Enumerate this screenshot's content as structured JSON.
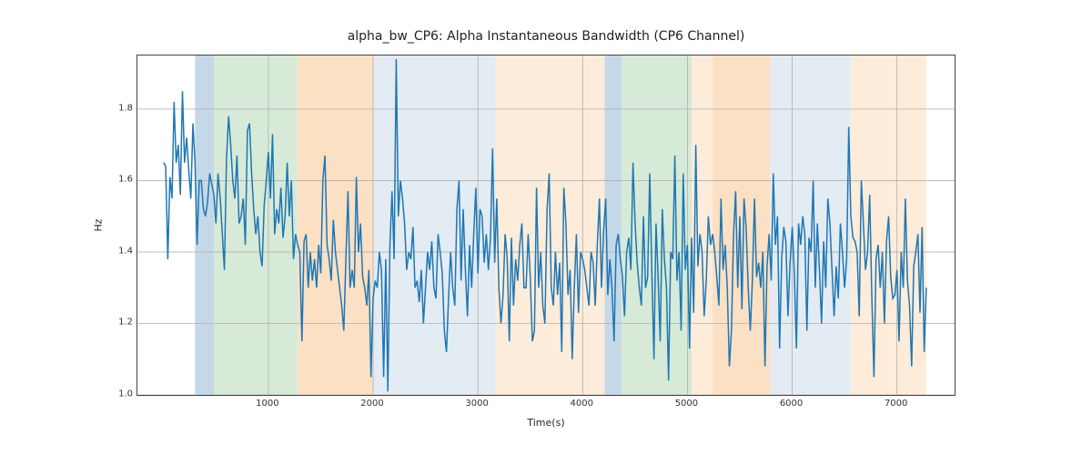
{
  "chart_data": {
    "type": "line",
    "title": "alpha_bw_CP6: Alpha Instantaneous Bandwidth (CP6 Channel)",
    "xlabel": "Time(s)",
    "ylabel": "Hz",
    "xlim": [
      -250,
      7550
    ],
    "ylim": [
      1.0,
      1.95
    ],
    "x_ticks": [
      1000,
      2000,
      3000,
      4000,
      5000,
      6000,
      7000
    ],
    "y_ticks": [
      1.0,
      1.2,
      1.4,
      1.6,
      1.8
    ],
    "bands": [
      {
        "start": 300,
        "end": 480,
        "color": "#c5d8e8",
        "label": "steelblue"
      },
      {
        "start": 480,
        "end": 1280,
        "color": "#d7ead7",
        "label": "green"
      },
      {
        "start": 1280,
        "end": 2000,
        "color": "#fbe0c4",
        "label": "orange"
      },
      {
        "start": 2000,
        "end": 3020,
        "color": "#e3ebf3",
        "label": "steelblue-light"
      },
      {
        "start": 3020,
        "end": 3170,
        "color": "#e3ebf3",
        "label": "steelblue-light"
      },
      {
        "start": 3170,
        "end": 4210,
        "color": "#fdecd9",
        "label": "orange-light"
      },
      {
        "start": 4210,
        "end": 4370,
        "color": "#c5d8e8",
        "label": "steelblue"
      },
      {
        "start": 4370,
        "end": 5040,
        "color": "#d7ead7",
        "label": "green"
      },
      {
        "start": 5040,
        "end": 5240,
        "color": "#fdecd9",
        "label": "orange-light"
      },
      {
        "start": 5240,
        "end": 5790,
        "color": "#fbe0c4",
        "label": "orange"
      },
      {
        "start": 5790,
        "end": 6560,
        "color": "#e3ebf3",
        "label": "steelblue-light"
      },
      {
        "start": 6560,
        "end": 7280,
        "color": "#fdecd9",
        "label": "orange-light"
      }
    ],
    "series": [
      {
        "name": "alpha_bw_CP6",
        "color": "#1f77b4",
        "x_step": 20,
        "values": [
          1.65,
          1.64,
          1.38,
          1.61,
          1.55,
          1.82,
          1.65,
          1.7,
          1.56,
          1.85,
          1.65,
          1.72,
          1.63,
          1.55,
          1.76,
          1.65,
          1.42,
          1.6,
          1.6,
          1.52,
          1.5,
          1.54,
          1.62,
          1.59,
          1.56,
          1.48,
          1.62,
          1.55,
          1.45,
          1.35,
          1.66,
          1.78,
          1.7,
          1.6,
          1.55,
          1.67,
          1.48,
          1.5,
          1.55,
          1.42,
          1.74,
          1.76,
          1.62,
          1.52,
          1.45,
          1.5,
          1.4,
          1.36,
          1.53,
          1.6,
          1.68,
          1.55,
          1.73,
          1.45,
          1.52,
          1.48,
          1.58,
          1.44,
          1.5,
          1.65,
          1.5,
          1.6,
          1.38,
          1.45,
          1.42,
          1.4,
          1.15,
          1.43,
          1.45,
          1.3,
          1.4,
          1.32,
          1.38,
          1.3,
          1.42,
          1.34,
          1.6,
          1.67,
          1.42,
          1.38,
          1.32,
          1.49,
          1.4,
          1.35,
          1.3,
          1.25,
          1.18,
          1.38,
          1.57,
          1.3,
          1.35,
          1.3,
          1.61,
          1.4,
          1.48,
          1.33,
          1.3,
          1.25,
          1.35,
          1.05,
          1.27,
          1.32,
          1.3,
          1.4,
          1.35,
          1.05,
          1.38,
          1.01,
          1.42,
          1.57,
          1.38,
          1.94,
          1.5,
          1.6,
          1.55,
          1.48,
          1.35,
          1.4,
          1.38,
          1.47,
          1.3,
          1.32,
          1.26,
          1.35,
          1.2,
          1.3,
          1.4,
          1.35,
          1.43,
          1.3,
          1.27,
          1.45,
          1.4,
          1.34,
          1.18,
          1.12,
          1.27,
          1.4,
          1.3,
          1.25,
          1.52,
          1.6,
          1.32,
          1.52,
          1.35,
          1.22,
          1.42,
          1.3,
          1.45,
          1.58,
          1.34,
          1.52,
          1.5,
          1.37,
          1.45,
          1.35,
          1.44,
          1.69,
          1.37,
          1.55,
          1.3,
          1.2,
          1.28,
          1.45,
          1.38,
          1.15,
          1.44,
          1.25,
          1.38,
          1.32,
          1.42,
          1.48,
          1.3,
          1.3,
          1.45,
          1.33,
          1.15,
          1.18,
          1.58,
          1.3,
          1.4,
          1.25,
          1.2,
          1.52,
          1.62,
          1.3,
          1.25,
          1.4,
          1.28,
          1.37,
          1.12,
          1.58,
          1.48,
          1.28,
          1.35,
          1.1,
          1.3,
          1.45,
          1.23,
          1.4,
          1.38,
          1.35,
          1.3,
          1.25,
          1.4,
          1.37,
          1.25,
          1.42,
          1.55,
          1.3,
          1.46,
          1.55,
          1.28,
          1.38,
          1.3,
          1.15,
          1.42,
          1.45,
          1.38,
          1.33,
          1.22,
          1.4,
          1.44,
          1.35,
          1.65,
          1.48,
          1.37,
          1.3,
          1.25,
          1.5,
          1.3,
          1.33,
          1.62,
          1.35,
          1.1,
          1.48,
          1.33,
          1.15,
          1.52,
          1.38,
          1.3,
          1.04,
          1.4,
          1.38,
          1.67,
          1.32,
          1.4,
          1.18,
          1.62,
          1.35,
          1.42,
          1.13,
          1.44,
          1.23,
          1.7,
          1.36,
          1.45,
          1.4,
          1.22,
          1.32,
          1.5,
          1.42,
          1.45,
          1.4,
          1.33,
          1.25,
          1.55,
          1.35,
          1.42,
          1.3,
          1.08,
          1.18,
          1.45,
          1.57,
          1.3,
          1.5,
          1.24,
          1.55,
          1.47,
          1.3,
          1.18,
          1.32,
          1.55,
          1.33,
          1.37,
          1.3,
          1.4,
          1.08,
          1.36,
          1.45,
          1.32,
          1.62,
          1.42,
          1.5,
          1.13,
          1.38,
          1.47,
          1.43,
          1.22,
          1.37,
          1.47,
          1.34,
          1.13,
          1.48,
          1.42,
          1.5,
          1.45,
          1.18,
          1.44,
          1.4,
          1.6,
          1.3,
          1.48,
          1.35,
          1.2,
          1.43,
          1.3,
          1.55,
          1.48,
          1.35,
          1.22,
          1.36,
          1.27,
          1.48,
          1.4,
          1.3,
          1.38,
          1.75,
          1.5,
          1.44,
          1.43,
          1.4,
          1.22,
          1.6,
          1.48,
          1.35,
          1.4,
          1.56,
          1.28,
          1.05,
          1.38,
          1.42,
          1.3,
          1.4,
          1.2,
          1.43,
          1.5,
          1.33,
          1.27,
          1.28,
          1.35,
          1.15,
          1.4,
          1.3,
          1.55,
          1.32,
          1.25,
          1.08,
          1.36,
          1.4,
          1.45,
          1.23,
          1.47,
          1.12,
          1.3
        ]
      }
    ]
  }
}
